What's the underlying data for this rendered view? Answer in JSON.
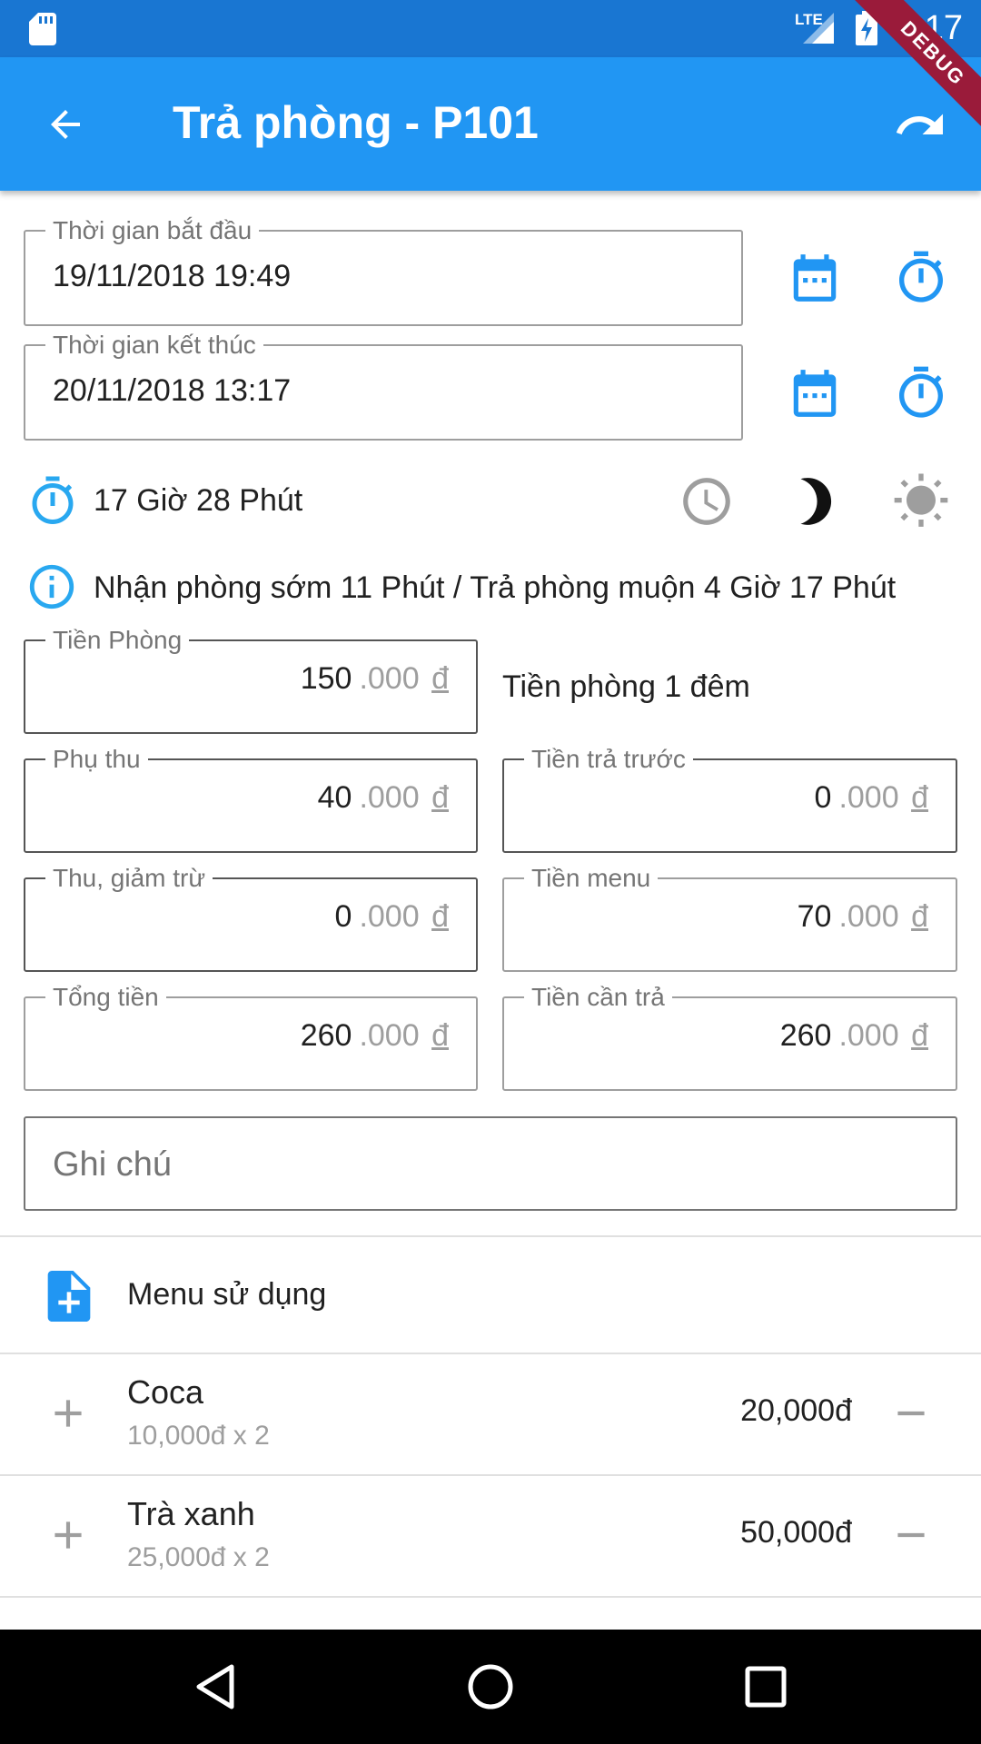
{
  "status_bar": {
    "time": "6:17",
    "network": "LTE"
  },
  "app_bar": {
    "title": "Trả phòng - P101",
    "debug_label": "DEBUG"
  },
  "start_time": {
    "label": "Thời gian bắt đầu",
    "value": "19/11/2018 19:49"
  },
  "end_time": {
    "label": "Thời gian kết thúc",
    "value": "20/11/2018 13:17"
  },
  "duration": {
    "text": "17 Giờ 28 Phút"
  },
  "info": {
    "text": "Nhận phòng sớm 11 Phút / Trả phòng muộn 4 Giờ 17 Phút"
  },
  "currency": {
    "suffix": ".000",
    "symbol": "đ"
  },
  "room_fee": {
    "label": "Tiền Phòng",
    "value": "150",
    "note": "Tiền phòng 1 đêm"
  },
  "surcharge": {
    "label": "Phụ thu",
    "value": "40"
  },
  "prepaid": {
    "label": "Tiền trả trước",
    "value": "0"
  },
  "deduction": {
    "label": "Thu, giảm trừ",
    "value": "0"
  },
  "menu_fee": {
    "label": "Tiền menu",
    "value": "70"
  },
  "total": {
    "label": "Tổng tiền",
    "value": "260"
  },
  "amount_due": {
    "label": "Tiền cần trả",
    "value": "260"
  },
  "note": {
    "placeholder": "Ghi chú"
  },
  "menu_section": {
    "title": "Menu sử dụng"
  },
  "menu_items": [
    {
      "name": "Coca",
      "detail": "10,000đ  x  2",
      "total": "20,000đ"
    },
    {
      "name": "Trà xanh",
      "detail": "25,000đ  x  2",
      "total": "50,000đ"
    }
  ],
  "colors": {
    "primary": "#2196f3",
    "status": "#1976d2",
    "icon_blue": "#2196f3",
    "icon_grey": "#9e9e9e",
    "debug": "#9a1b3a"
  },
  "icons": [
    "sd-card-icon",
    "signal-icon",
    "battery-charging-icon",
    "back-arrow-icon",
    "redo-icon",
    "calendar-icon",
    "timer-icon",
    "clock-icon",
    "moon-icon",
    "sun-icon",
    "info-icon",
    "note-add-icon",
    "plus-icon",
    "minus-icon",
    "nav-back-icon",
    "nav-home-icon",
    "nav-recents-icon"
  ]
}
